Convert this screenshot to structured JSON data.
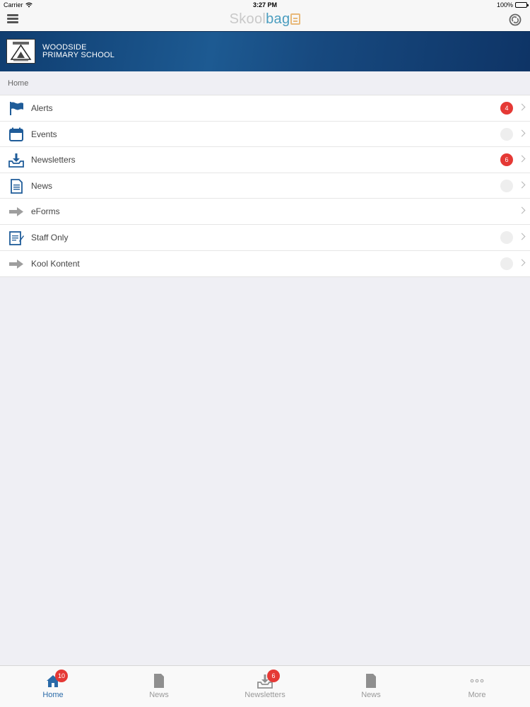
{
  "status_bar": {
    "carrier": "Carrier",
    "time": "3:27 PM",
    "battery": "100%"
  },
  "nav": {
    "logo_part1": "Skool",
    "logo_part2": "bag"
  },
  "school": {
    "name_line1": "WOODSIDE",
    "name_line2": "PRIMARY SCHOOL"
  },
  "breadcrumb": "Home",
  "menu": [
    {
      "label": "Alerts",
      "badge": "4",
      "icon": "flag-icon"
    },
    {
      "label": "Events",
      "badge": "",
      "icon": "calendar-icon"
    },
    {
      "label": "Newsletters",
      "badge": "6",
      "icon": "inbox-download-icon"
    },
    {
      "label": "News",
      "badge": "",
      "icon": "document-icon"
    },
    {
      "label": "eForms",
      "badge": null,
      "icon": "arrow-right-icon"
    },
    {
      "label": "Staff Only",
      "badge": "",
      "icon": "notepad-icon"
    },
    {
      "label": "Kool Kontent",
      "badge": "",
      "icon": "arrow-right-icon"
    }
  ],
  "tabs": [
    {
      "label": "Home",
      "badge": "10",
      "icon": "home-icon",
      "active": true
    },
    {
      "label": "News",
      "badge": null,
      "icon": "document-icon",
      "active": false
    },
    {
      "label": "Newsletters",
      "badge": "6",
      "icon": "inbox-download-icon",
      "active": false
    },
    {
      "label": "News",
      "badge": null,
      "icon": "document-icon",
      "active": false
    },
    {
      "label": "More",
      "badge": null,
      "icon": "more-dots-icon",
      "active": false
    }
  ],
  "colors": {
    "accent": "#2a6aa8",
    "badge": "#e53935",
    "banner": "#1d5a92"
  }
}
